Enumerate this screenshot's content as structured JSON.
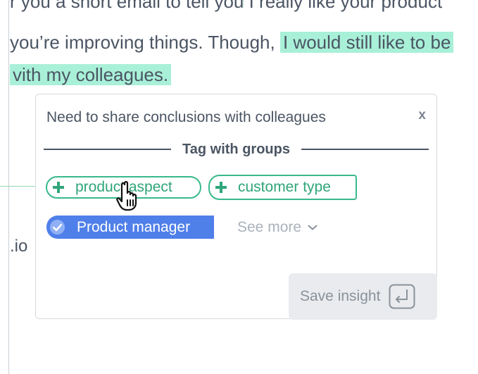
{
  "document": {
    "line1": "r you a short email to tell you I really like your product",
    "line2_plain": "you’re improving things. Though, ",
    "line2_highlight": "I would still like to be",
    "line3_highlight": "vith my colleagues.",
    "side_text": ".io"
  },
  "card": {
    "title": "Need to share conclusions with colleagues",
    "close_label": "x",
    "section_label": "Tag with groups",
    "suggested_tags": [
      {
        "label": "product aspect"
      },
      {
        "label": "customer type"
      }
    ],
    "selected_tag": {
      "label": "Product manager"
    },
    "see_more_label": "See more",
    "save_label": "Save insight"
  },
  "colors": {
    "highlight": "#a9f0d8",
    "tag_green": "#38b98a",
    "selected_blue": "#4f7fe9",
    "text": "#4b5563"
  },
  "icons": {
    "plus": "plus-icon",
    "check": "check-circle-icon",
    "chevron": "chevron-down-icon",
    "enter": "enter-key-icon",
    "cursor": "hand-pointer-icon"
  }
}
